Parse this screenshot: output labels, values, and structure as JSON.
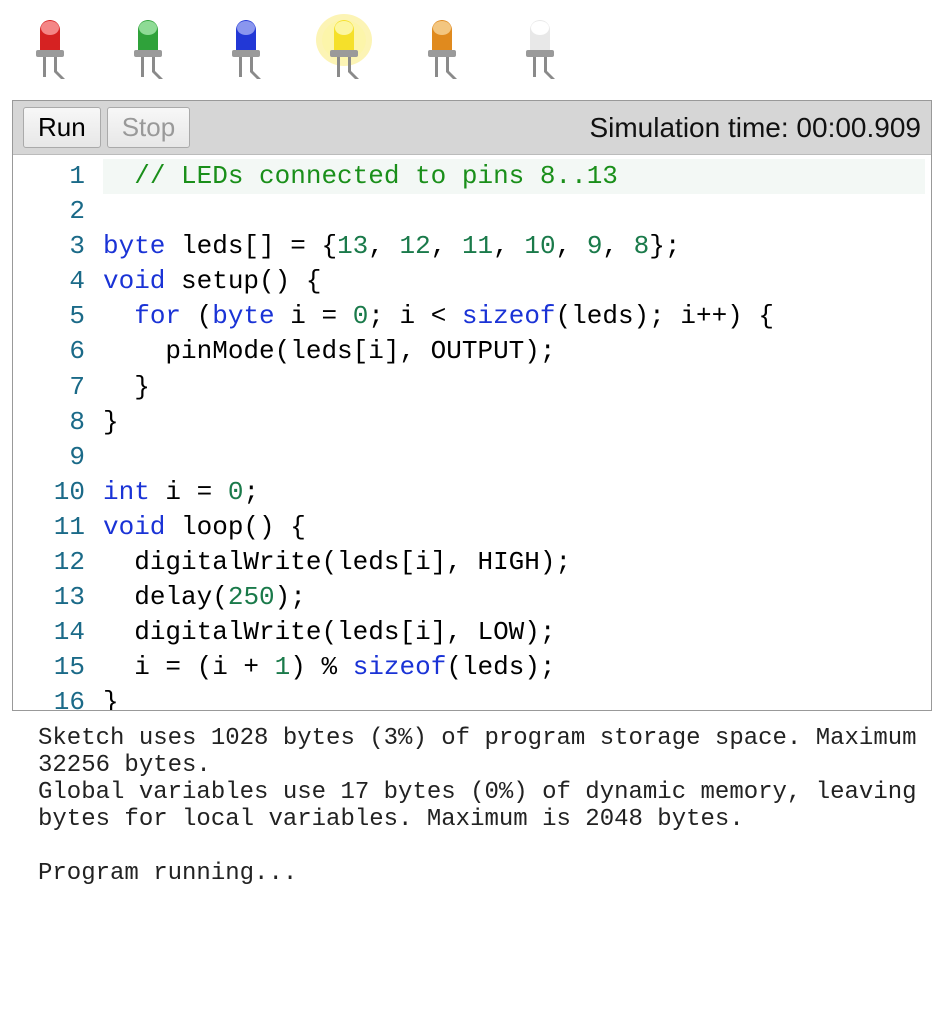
{
  "leds": [
    {
      "name": "led-red",
      "body": "#d62222",
      "top": "#f48686",
      "lit": false
    },
    {
      "name": "led-green",
      "body": "#2fa23a",
      "top": "#8edb95",
      "lit": false
    },
    {
      "name": "led-blue",
      "body": "#2238d6",
      "top": "#8a96ee",
      "lit": false
    },
    {
      "name": "led-yellow",
      "body": "#f5e02a",
      "top": "#fcf6a0",
      "lit": true
    },
    {
      "name": "led-orange",
      "body": "#e08a1e",
      "top": "#f3c680",
      "lit": false
    },
    {
      "name": "led-white",
      "body": "#e8e8e8",
      "top": "#ffffff",
      "lit": false
    }
  ],
  "toolbar": {
    "run_label": "Run",
    "stop_label": "Stop",
    "stop_disabled": true,
    "sim_time_label": "Simulation time: ",
    "sim_time_value": "00:00.909"
  },
  "code": {
    "lines": [
      {
        "n": 1,
        "indent": 1,
        "hl": true,
        "tokens": [
          {
            "t": "// LEDs connected to pins 8..13",
            "c": "c-comment"
          }
        ]
      },
      {
        "n": 2,
        "indent": 0,
        "tokens": []
      },
      {
        "n": 3,
        "indent": 0,
        "tokens": [
          {
            "t": "byte",
            "c": "c-type"
          },
          {
            "t": " leds[] = {"
          },
          {
            "t": "13",
            "c": "c-num"
          },
          {
            "t": ", "
          },
          {
            "t": "12",
            "c": "c-num"
          },
          {
            "t": ", "
          },
          {
            "t": "11",
            "c": "c-num"
          },
          {
            "t": ", "
          },
          {
            "t": "10",
            "c": "c-num"
          },
          {
            "t": ", "
          },
          {
            "t": "9",
            "c": "c-num"
          },
          {
            "t": ", "
          },
          {
            "t": "8",
            "c": "c-num"
          },
          {
            "t": "};"
          }
        ]
      },
      {
        "n": 4,
        "indent": 0,
        "tokens": [
          {
            "t": "void",
            "c": "c-keyword"
          },
          {
            "t": " setup() {"
          }
        ]
      },
      {
        "n": 5,
        "indent": 1,
        "tokens": [
          {
            "t": "for",
            "c": "c-keyword"
          },
          {
            "t": " ("
          },
          {
            "t": "byte",
            "c": "c-type"
          },
          {
            "t": " i = "
          },
          {
            "t": "0",
            "c": "c-num"
          },
          {
            "t": "; i < "
          },
          {
            "t": "sizeof",
            "c": "c-keyword"
          },
          {
            "t": "(leds); i++) {"
          }
        ]
      },
      {
        "n": 6,
        "indent": 2,
        "tokens": [
          {
            "t": "pinMode(leds[i], OUTPUT);"
          }
        ]
      },
      {
        "n": 7,
        "indent": 1,
        "tokens": [
          {
            "t": "}"
          }
        ]
      },
      {
        "n": 8,
        "indent": 0,
        "tokens": [
          {
            "t": "}"
          }
        ]
      },
      {
        "n": 9,
        "indent": 0,
        "tokens": []
      },
      {
        "n": 10,
        "indent": 0,
        "tokens": [
          {
            "t": "int",
            "c": "c-type"
          },
          {
            "t": " i = "
          },
          {
            "t": "0",
            "c": "c-num"
          },
          {
            "t": ";"
          }
        ]
      },
      {
        "n": 11,
        "indent": 0,
        "tokens": [
          {
            "t": "void",
            "c": "c-keyword"
          },
          {
            "t": " loop() {"
          }
        ]
      },
      {
        "n": 12,
        "indent": 1,
        "tokens": [
          {
            "t": "digitalWrite(leds[i], HIGH);"
          }
        ]
      },
      {
        "n": 13,
        "indent": 1,
        "tokens": [
          {
            "t": "delay("
          },
          {
            "t": "250",
            "c": "c-num"
          },
          {
            "t": ");"
          }
        ]
      },
      {
        "n": 14,
        "indent": 1,
        "tokens": [
          {
            "t": "digitalWrite(leds[i], LOW);"
          }
        ]
      },
      {
        "n": 15,
        "indent": 1,
        "tokens": [
          {
            "t": "i = (i + "
          },
          {
            "t": "1",
            "c": "c-num"
          },
          {
            "t": ") % "
          },
          {
            "t": "sizeof",
            "c": "c-keyword"
          },
          {
            "t": "(leds);"
          }
        ]
      },
      {
        "n": 16,
        "indent": 0,
        "tokens": [
          {
            "t": "}"
          }
        ]
      }
    ]
  },
  "console": {
    "text": "Sketch uses 1028 bytes (3%) of program storage space. Maximum 32256 bytes.\nGlobal variables use 17 bytes (0%) of dynamic memory, leaving bytes for local variables. Maximum is 2048 bytes.\n\nProgram running..."
  }
}
